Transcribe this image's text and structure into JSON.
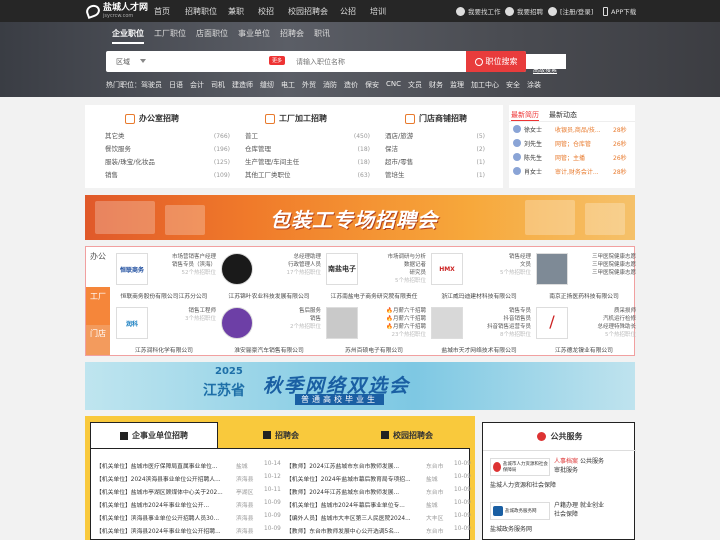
{
  "topnav": {
    "logo_title": "盐城人才网",
    "logo_sub": "jsycrcw.com",
    "nav": [
      "首页",
      "招聘职位",
      "兼职",
      "校招",
      "校园招聘会",
      "公招",
      "培训"
    ],
    "right": {
      "employer": "我要找工作",
      "recruit": "我要招聘",
      "login": "[注册/登录]",
      "app": "APP下载"
    }
  },
  "search": {
    "tabs": [
      "企业职位",
      "工厂职位",
      "店面职位",
      "事业单位",
      "招聘会",
      "职讯"
    ],
    "region_label": "区域",
    "more_badge": "更多",
    "placeholder": "请输入职位名称",
    "button": "职位搜索",
    "advanced": "高级搜索",
    "hot_prefix": "热门职位：",
    "hot": [
      "驾驶员",
      "日语",
      "会计",
      "司机",
      "建造师",
      "缝纫",
      "电工",
      "外贸",
      "消防",
      "造价",
      "保安",
      "CNC",
      "文员",
      "财务",
      "监理",
      "加工中心",
      "安全",
      "涂装"
    ]
  },
  "jobpanel": {
    "columns": [
      {
        "title": "办公室招聘",
        "rows": [
          {
            "n": "其它类",
            "c": "(766)"
          },
          {
            "n": "餐饮服务",
            "c": "(196)"
          },
          {
            "n": "服装/珠宝/化妆品",
            "c": "(125)"
          },
          {
            "n": "销售",
            "c": "(109)"
          }
        ]
      },
      {
        "title": "工厂加工招聘",
        "rows": [
          {
            "n": "普工",
            "c": "(450)"
          },
          {
            "n": "仓库管理",
            "c": "(18)"
          },
          {
            "n": "生产管理/车间主任",
            "c": "(18)"
          },
          {
            "n": "其他工厂类职位",
            "c": "(63)"
          }
        ]
      },
      {
        "title": "门店商铺招聘",
        "rows": [
          {
            "n": "酒店/旅游",
            "c": "(5)"
          },
          {
            "n": "保洁",
            "c": "(2)"
          },
          {
            "n": "超市/零售",
            "c": "(1)"
          },
          {
            "n": "管培生",
            "c": "(1)"
          }
        ]
      }
    ]
  },
  "recent": {
    "tabs": [
      "最新简历",
      "最新动态"
    ],
    "items": [
      {
        "name": "徐女士",
        "job": "收银员,商品/技...",
        "time": "28秒"
      },
      {
        "name": "刘先生",
        "job": "网管；仓库管",
        "time": "26秒"
      },
      {
        "name": "陈先生",
        "job": "网管；主播",
        "time": "26秒"
      },
      {
        "name": "肖女士",
        "job": "审计,财务会计...",
        "time": "28秒"
      }
    ]
  },
  "banner1": {
    "text": "包装工专场招聘会"
  },
  "companies": {
    "side": [
      "办公",
      "工厂",
      "门店"
    ],
    "items": [
      {
        "logo": "恒联商务",
        "jobs": [
          "市场营销客户经理",
          "销售专员（滨海）"
        ],
        "extra": "52个热招职位",
        "name": "恒联商务股份有限公司江苏分公司"
      },
      {
        "logo": "",
        "jobs": [
          "总经理助理",
          "行政管理人员"
        ],
        "extra": "17个热招职位",
        "name": "江苏锦叶农业科技发展有限公司"
      },
      {
        "logo": "南盐电子",
        "jobs": [
          "市场调研与分析",
          "数据记者",
          "研究员"
        ],
        "extra": "5个热招职位",
        "name": "江苏南盐电子商务研究院有限责任"
      },
      {
        "logo": "HMX",
        "jobs": [
          "销售经理",
          "文员"
        ],
        "extra": "5个热招职位",
        "name": "浙江威玛迪建材科技有限公司"
      },
      {
        "logo": "",
        "jobs": [
          "三甲医院健康志愿",
          "三甲医院健康志愿",
          "三甲医院健康志愿"
        ],
        "extra": "",
        "name": "南京正扬医药科技有限公司"
      },
      {
        "logo": "润科",
        "jobs": [
          "销售工程师"
        ],
        "extra": "3个热招职位",
        "name": "江苏润科化学有限公司"
      },
      {
        "logo": "",
        "jobs": [
          "售后服务",
          "销售"
        ],
        "extra": "2个热招职位",
        "name": "淮安骊豪汽车销售有限公司"
      },
      {
        "logo": "",
        "jobs": [
          "🔥月薪六千招聘",
          "🔥月薪六千招聘",
          "🔥月薪六千招聘"
        ],
        "extra": "23个热招职位",
        "name": "苏州百硕电子有限公司"
      },
      {
        "logo": "",
        "jobs": [
          "销售专员",
          "抖音销售员",
          "抖音销售运营专员"
        ],
        "extra": "8个热招职位",
        "name": "盐城市天才网络技术有限公司"
      },
      {
        "logo": "",
        "jobs": [
          "质采损师",
          "汽机运行检修",
          "总经理特殊助长"
        ],
        "extra": "5个热招职位",
        "name": "江苏德龙镍业有限公司"
      }
    ]
  },
  "banner2": {
    "year": "2025",
    "province": "江苏省",
    "main": "秋季网络双选会",
    "sub": "普通高校毕业生"
  },
  "bottom": {
    "tabs": [
      "企事业单位招聘",
      "招聘会",
      "校园招聘会"
    ],
    "left": [
      {
        "t": "【机关单位】盐城市医疗保障局直属事业单位...",
        "p": "盐城",
        "d": "10-14"
      },
      {
        "t": "【机关单位】2024滨海县事业单位公开招聘人...",
        "p": "滨海县",
        "d": "10-12"
      },
      {
        "t": "【机关单位】盐城市亭湖区顾煤体中心关于202...",
        "p": "亭湖区",
        "d": "10-11"
      },
      {
        "t": "【机关单位】盐城市2024年事业单位公开...",
        "p": "滨海县",
        "d": "10-09"
      },
      {
        "t": "【机关单位】滨海县事业单位公开招聘人员30...",
        "p": "滨海县",
        "d": "10-09"
      },
      {
        "t": "【机关单位】滨海县2024年事业单位公开招聘...",
        "p": "滨海县",
        "d": "10-09"
      }
    ],
    "right": [
      {
        "t": "【教师】2024江苏盐城市东台市教师发展...",
        "p": "东台市",
        "d": "10-09"
      },
      {
        "t": "【机关单位】2024年盐城市幕后教育局专项招...",
        "p": "盐城",
        "d": "10-09"
      },
      {
        "t": "【教师】2024年江苏盐城东台市教师发展...",
        "p": "东台市",
        "d": "10-09"
      },
      {
        "t": "【机关单位】盐城市2024年幕后事业单位专...",
        "p": "盐城",
        "d": "10-09"
      },
      {
        "t": "【编外人员】盐城市大丰区第三人民医院2024...",
        "p": "大丰区",
        "d": "10-09"
      },
      {
        "t": "【教师】东台市教师发展中心公开选调5名...",
        "p": "东台市",
        "d": "10-09"
      }
    ]
  },
  "public": {
    "title": "公共服务",
    "items": [
      {
        "logo": "盐城市人力资源和社会保障局",
        "links": [
          "人事档案",
          "公共服务",
          "审批服务"
        ],
        "name": "盐城人力资源和社会保障"
      },
      {
        "logo": "盐城政务服务网",
        "links": [
          "户籍办理",
          "就业创业",
          "社会保障"
        ],
        "name": "盐城政务服务网"
      }
    ]
  }
}
